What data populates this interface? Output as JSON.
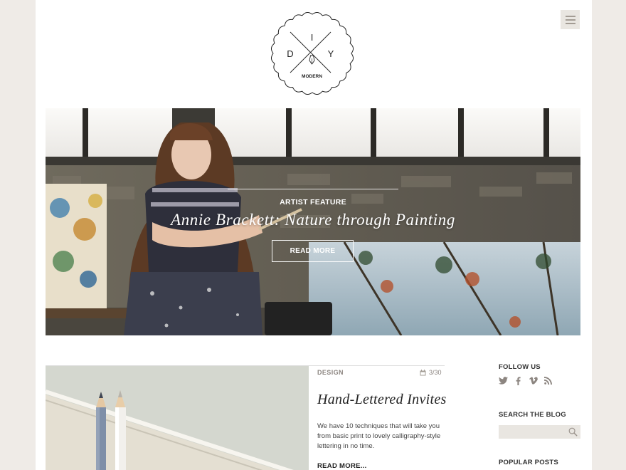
{
  "logo": {
    "letters": [
      "D",
      "I",
      "Y"
    ],
    "tagline": "MODERN"
  },
  "hero": {
    "category": "ARTIST FEATURE",
    "title": "Annie Brackett: Nature through Painting",
    "button_label": "READ MORE"
  },
  "post": {
    "category": "DESIGN",
    "date": "3/30",
    "title": "Hand-Lettered Invites",
    "excerpt": "We have 10 techniques that will take you from basic print to lovely calligraphy-style lettering in no time.",
    "read_more": "READ MORE..."
  },
  "sidebar": {
    "follow_heading": "FOLLOW US",
    "social_icons": [
      "twitter-icon",
      "facebook-icon",
      "vimeo-icon",
      "rss-icon"
    ],
    "search_heading": "SEARCH THE BLOG",
    "search_value": "",
    "popular_heading": "POPULAR POSTS"
  },
  "colors": {
    "background": "#efebe7",
    "card": "#ffffff",
    "muted_text": "#8c8580",
    "search_bg": "#e9e6e1"
  }
}
